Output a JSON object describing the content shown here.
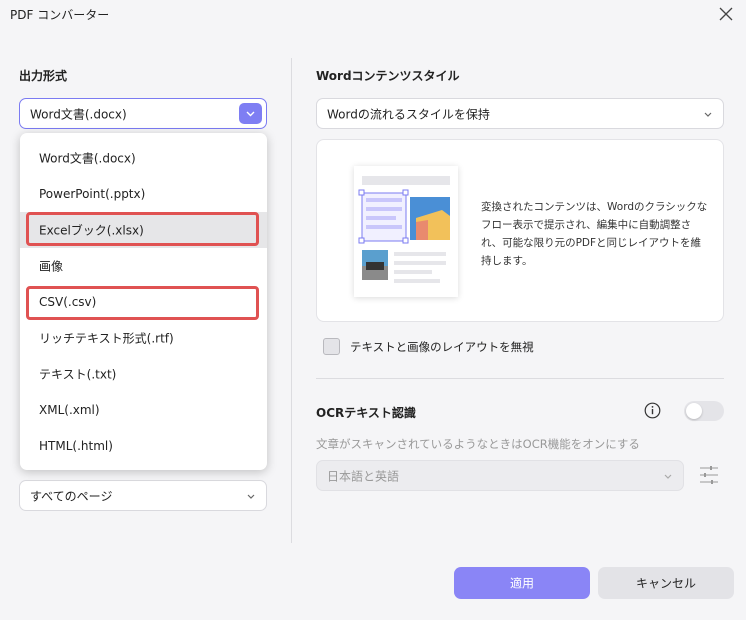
{
  "window": {
    "title": "PDF コンバーター"
  },
  "output_format": {
    "label": "出力形式",
    "selected": "Word文書(.docx)",
    "options": [
      "Word文書(.docx)",
      "PowerPoint(.pptx)",
      "Excelブック(.xlsx)",
      "画像",
      "CSV(.csv)",
      "リッチテキスト形式(.rtf)",
      "テキスト(.txt)",
      "XML(.xml)",
      "HTML(.html)"
    ],
    "highlighted_option": "Excelブック(.xlsx)",
    "annotated_options": [
      "Excelブック(.xlsx)",
      "CSV(.csv)"
    ]
  },
  "page_range": {
    "selected": "すべてのページ"
  },
  "word_style": {
    "label": "Wordコンテンツスタイル",
    "selected": "Wordの流れるスタイルを保持",
    "description": "変換されたコンテンツは、Wordのクラシックなフロー表示で提示され、編集中に自動調整され、可能な限り元のPDFと同じレイアウトを維持します。",
    "ignore_layout_label": "テキストと画像のレイアウトを無視",
    "ignore_layout_checked": false
  },
  "ocr": {
    "label": "OCRテキスト認識",
    "enabled": false,
    "description": "文章がスキャンされているようなときはOCR機能をオンにする",
    "language": "日本語と英語"
  },
  "buttons": {
    "apply": "適用",
    "cancel": "キャンセル"
  },
  "colors": {
    "accent": "#8a85f6",
    "highlight_border": "#e05252",
    "background": "#f5f5f7"
  }
}
